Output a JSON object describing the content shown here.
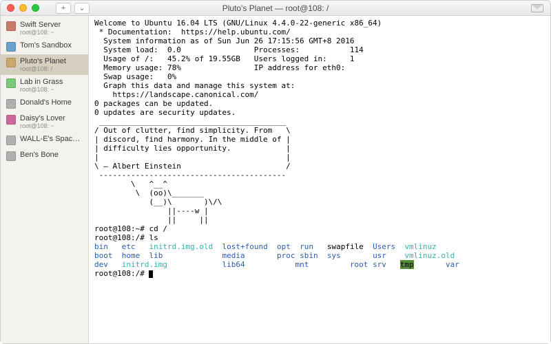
{
  "title": "Pluto's Planet — root@108: /",
  "toolbar": {
    "add": "+",
    "down": "⌄"
  },
  "sidebar": {
    "items": [
      {
        "name": "Swift Server",
        "sub": "root@108: ~",
        "color": "#c97a6a"
      },
      {
        "name": "Tom's Sandbox",
        "sub": "",
        "color": "#6aa0c9"
      },
      {
        "name": "Pluto's Planet",
        "sub": "root@108: /",
        "color": "#c9a96a",
        "active": true
      },
      {
        "name": "Lab in Grass",
        "sub": "root@108: ~",
        "color": "#7ac97a"
      },
      {
        "name": "Donald's Home",
        "sub": "",
        "color": "#b0b0b0"
      },
      {
        "name": "Daisy's Lover",
        "sub": "root@108: ~",
        "color": "#c96a9a"
      },
      {
        "name": "WALL-E's Spacecraft",
        "sub": "",
        "color": "#b0b0b0"
      },
      {
        "name": "Ben's Bone",
        "sub": "",
        "color": "#b0b0b0"
      }
    ]
  },
  "term": {
    "welcome": "Welcome to Ubuntu 16.04 LTS (GNU/Linux 4.4.0-22-generic x86_64)",
    "doc_label": " * Documentation:  https://help.ubuntu.com/",
    "sysinfo_header": "  System information as of Sun Jun 26 17:15:56 GMT+8 2016",
    "stats": [
      "  System load:  0.0                Processes:           114",
      "  Usage of /:   45.2% of 19.55GB   Users logged in:     1",
      "  Memory usage: 78%                IP address for eth0:",
      "  Swap usage:   0%"
    ],
    "graph1": "  Graph this data and manage this system at:",
    "graph2": "    https://landscape.canonical.com/",
    "pkg1": "0 packages can be updated.",
    "pkg2": "0 updates are security updates.",
    "cow": [
      " _________________________________________",
      "/ Out of clutter, find simplicity. From   \\",
      "| discord, find harmony. In the middle of |",
      "| difficulty lies opportunity.            |",
      "|                                         |",
      "\\ — Albert Einstein                       /",
      " -----------------------------------------",
      "        \\   ^__^",
      "         \\  (oo)\\_______",
      "            (__)\\       )\\/\\",
      "                ||----w |",
      "                ||     ||"
    ],
    "prompt1": "root@108:~# cd /",
    "prompt2": "root@108:/# ls",
    "ls_rows": [
      [
        {
          "t": "bin",
          "c": "blue",
          "w": 6
        },
        {
          "t": "etc",
          "c": "blue",
          "w": 6
        },
        {
          "t": "initrd.img.old",
          "c": "cyan",
          "w": 16
        },
        {
          "t": "lost+found",
          "c": "blue",
          "w": 12
        },
        {
          "t": "opt",
          "c": "blue",
          "w": 5
        },
        {
          "t": "run",
          "c": "blue",
          "w": 6
        },
        {
          "t": "swapfile",
          "c": "",
          "w": 10
        },
        {
          "t": "Users",
          "c": "blue",
          "w": 7
        },
        {
          "t": "vmlinuz",
          "c": "cyan",
          "w": 0
        }
      ],
      [
        {
          "t": "boot",
          "c": "blue",
          "w": 6
        },
        {
          "t": "home",
          "c": "blue",
          "w": 6
        },
        {
          "t": "lib",
          "c": "blue",
          "w": 16
        },
        {
          "t": "media",
          "c": "blue",
          "w": 12
        },
        {
          "t": "proc",
          "c": "blue",
          "w": 5
        },
        {
          "t": "sbin",
          "c": "blue",
          "w": 6
        },
        {
          "t": "sys",
          "c": "blue",
          "w": 10
        },
        {
          "t": "usr",
          "c": "blue",
          "w": 7
        },
        {
          "t": "vmlinuz.old",
          "c": "cyan",
          "w": 0
        }
      ],
      [
        {
          "t": "dev",
          "c": "blue",
          "w": 6
        },
        {
          "t": "initrd.img",
          "c": "cyan",
          "w": 22
        },
        {
          "t": "lib64",
          "c": "blue",
          "w": 16
        },
        {
          "t": "mnt",
          "c": "blue",
          "w": 12
        },
        {
          "t": "root",
          "c": "blue",
          "w": 5
        },
        {
          "t": "srv",
          "c": "blue",
          "w": 6
        },
        {
          "t": "tmp",
          "c": "hl",
          "w": 10
        },
        {
          "t": "var",
          "c": "blue",
          "w": 0
        }
      ]
    ],
    "prompt3": "root@108:/# "
  }
}
